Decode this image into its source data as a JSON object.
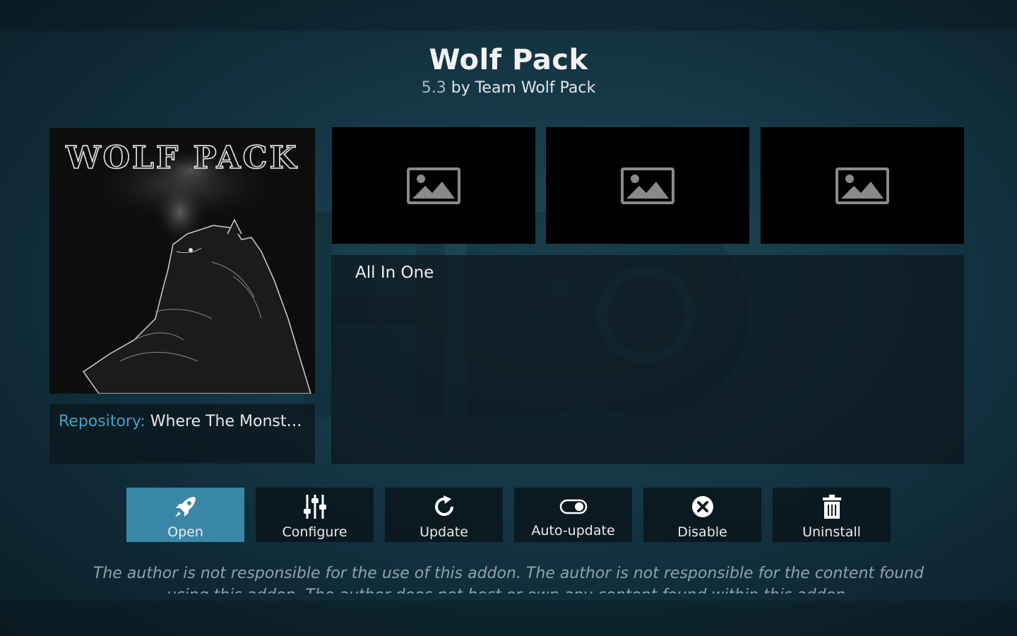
{
  "addon": {
    "title": "Wolf Pack",
    "version": "5.3",
    "by_text": "by Team Wolf Pack",
    "poster_text": "WOLF PACK"
  },
  "repository": {
    "label": "Repository:",
    "value": "Where The Monste…"
  },
  "screenshots": [
    "image-placeholder-icon",
    "image-placeholder-icon",
    "image-placeholder-icon"
  ],
  "description": {
    "summary": "All In One"
  },
  "buttons": {
    "open": "Open",
    "configure": "Configure",
    "update": "Update",
    "auto_update": "Auto-update",
    "disable": "Disable",
    "uninstall": "Uninstall"
  },
  "disclaimer": "The author is not responsible for the use of this addon. The author is not responsible for the content found using this addon. The author does not host or own any content found within this addon.",
  "colors": {
    "accent": "#3a87a8",
    "repo_label": "#3fa2cc"
  }
}
